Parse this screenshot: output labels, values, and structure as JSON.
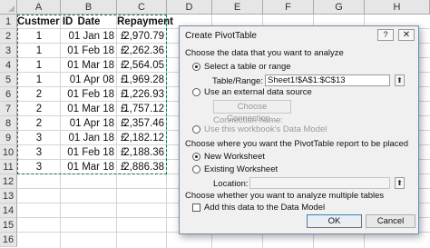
{
  "sheet": {
    "columns": [
      "A",
      "B",
      "C",
      "D",
      "E",
      "F",
      "G",
      "H"
    ],
    "rows": [
      "1",
      "2",
      "3",
      "4",
      "5",
      "6",
      "7",
      "8",
      "9",
      "10",
      "11",
      "12",
      "13",
      "14",
      "15",
      "16"
    ],
    "headers": {
      "a": "Custmer ID",
      "b": "Date",
      "c": "Repayment"
    },
    "currency": "£",
    "data": [
      {
        "id": "1",
        "date": "01 Jan 18",
        "amount": "2,970.79"
      },
      {
        "id": "1",
        "date": "01 Feb 18",
        "amount": "2,262.36"
      },
      {
        "id": "1",
        "date": "01 Mar 18",
        "amount": "2,564.05"
      },
      {
        "id": "1",
        "date": "01 Apr 08",
        "amount": "1,969.28"
      },
      {
        "id": "2",
        "date": "01 Feb 18",
        "amount": "1,226.93"
      },
      {
        "id": "2",
        "date": "01 Mar 18",
        "amount": "1,757.12"
      },
      {
        "id": "2",
        "date": "01 Apr 18",
        "amount": "2,357.46"
      },
      {
        "id": "3",
        "date": "01 Jan 18",
        "amount": "2,182.12"
      },
      {
        "id": "3",
        "date": "01 Feb 18",
        "amount": "2,188.36"
      },
      {
        "id": "3",
        "date": "01 Mar 18",
        "amount": "2,886.38"
      }
    ]
  },
  "dialog": {
    "title": "Create PivotTable",
    "help_label": "?",
    "close_label": "✕",
    "section_data": "Choose the data that you want to analyze",
    "opt_select_table": "Select a table or range",
    "table_range_label": "Table/Range:",
    "table_range_value": "Sheet1!$A$1:$C$13",
    "collapse_label": "⬆",
    "opt_external": "Use an external data source",
    "choose_connection": "Choose Connection...",
    "connection_name_label": "Connection name:",
    "opt_data_model": "Use this workbook's Data Model",
    "section_location": "Choose where you want the PivotTable report to be placed",
    "opt_new_ws": "New Worksheet",
    "opt_existing_ws": "Existing Worksheet",
    "location_label": "Location:",
    "location_value": "",
    "section_multiple": "Choose whether you want to analyze multiple tables",
    "add_data_model": "Add this data to the Data Model",
    "ok_label": "OK",
    "cancel_label": "Cancel"
  }
}
